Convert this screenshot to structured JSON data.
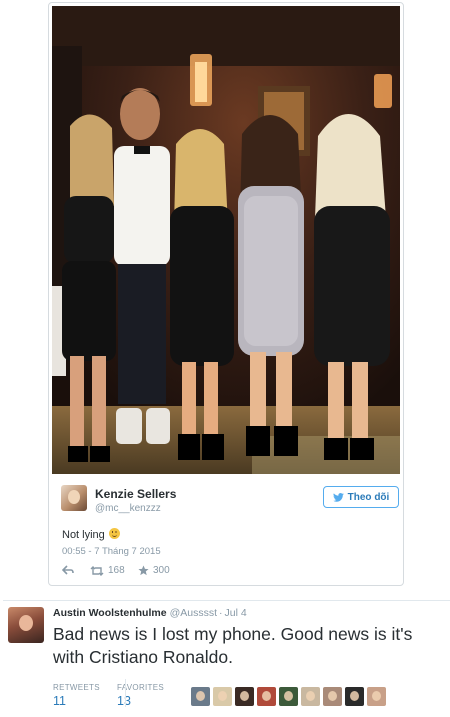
{
  "tweet1": {
    "author_name": "Kenzie Sellers",
    "author_handle": "@mc__kenzzz",
    "follow_label": "Theo dõi",
    "text": "Not lying",
    "timestamp": "00:55 - 7 Tháng 7 2015",
    "retweets": "168",
    "favorites": "300"
  },
  "tweet2": {
    "author_name": "Austin Woolstenhulme",
    "author_handle": "@Ausssst",
    "separator": "·",
    "date": "Jul 4",
    "text": "Bad news is I lost my phone. Good news is it's with Cristiano Ronaldo.",
    "retweets_label": "RETWEETS",
    "retweets_value": "11",
    "favorites_label": "FAVORITES",
    "favorites_value": "13",
    "favoriter_avatar_colors": [
      "#6a7a8a",
      "#d9c9a8",
      "#3a2a24",
      "#b04a3a",
      "#3c5a3a",
      "#c9b8a0",
      "#a98a78",
      "#2a2a2a",
      "#c8a088"
    ]
  },
  "colors": {
    "accent": "#55acee",
    "link": "#2b7bb9",
    "muted": "#8899a6",
    "text": "#292f33"
  }
}
